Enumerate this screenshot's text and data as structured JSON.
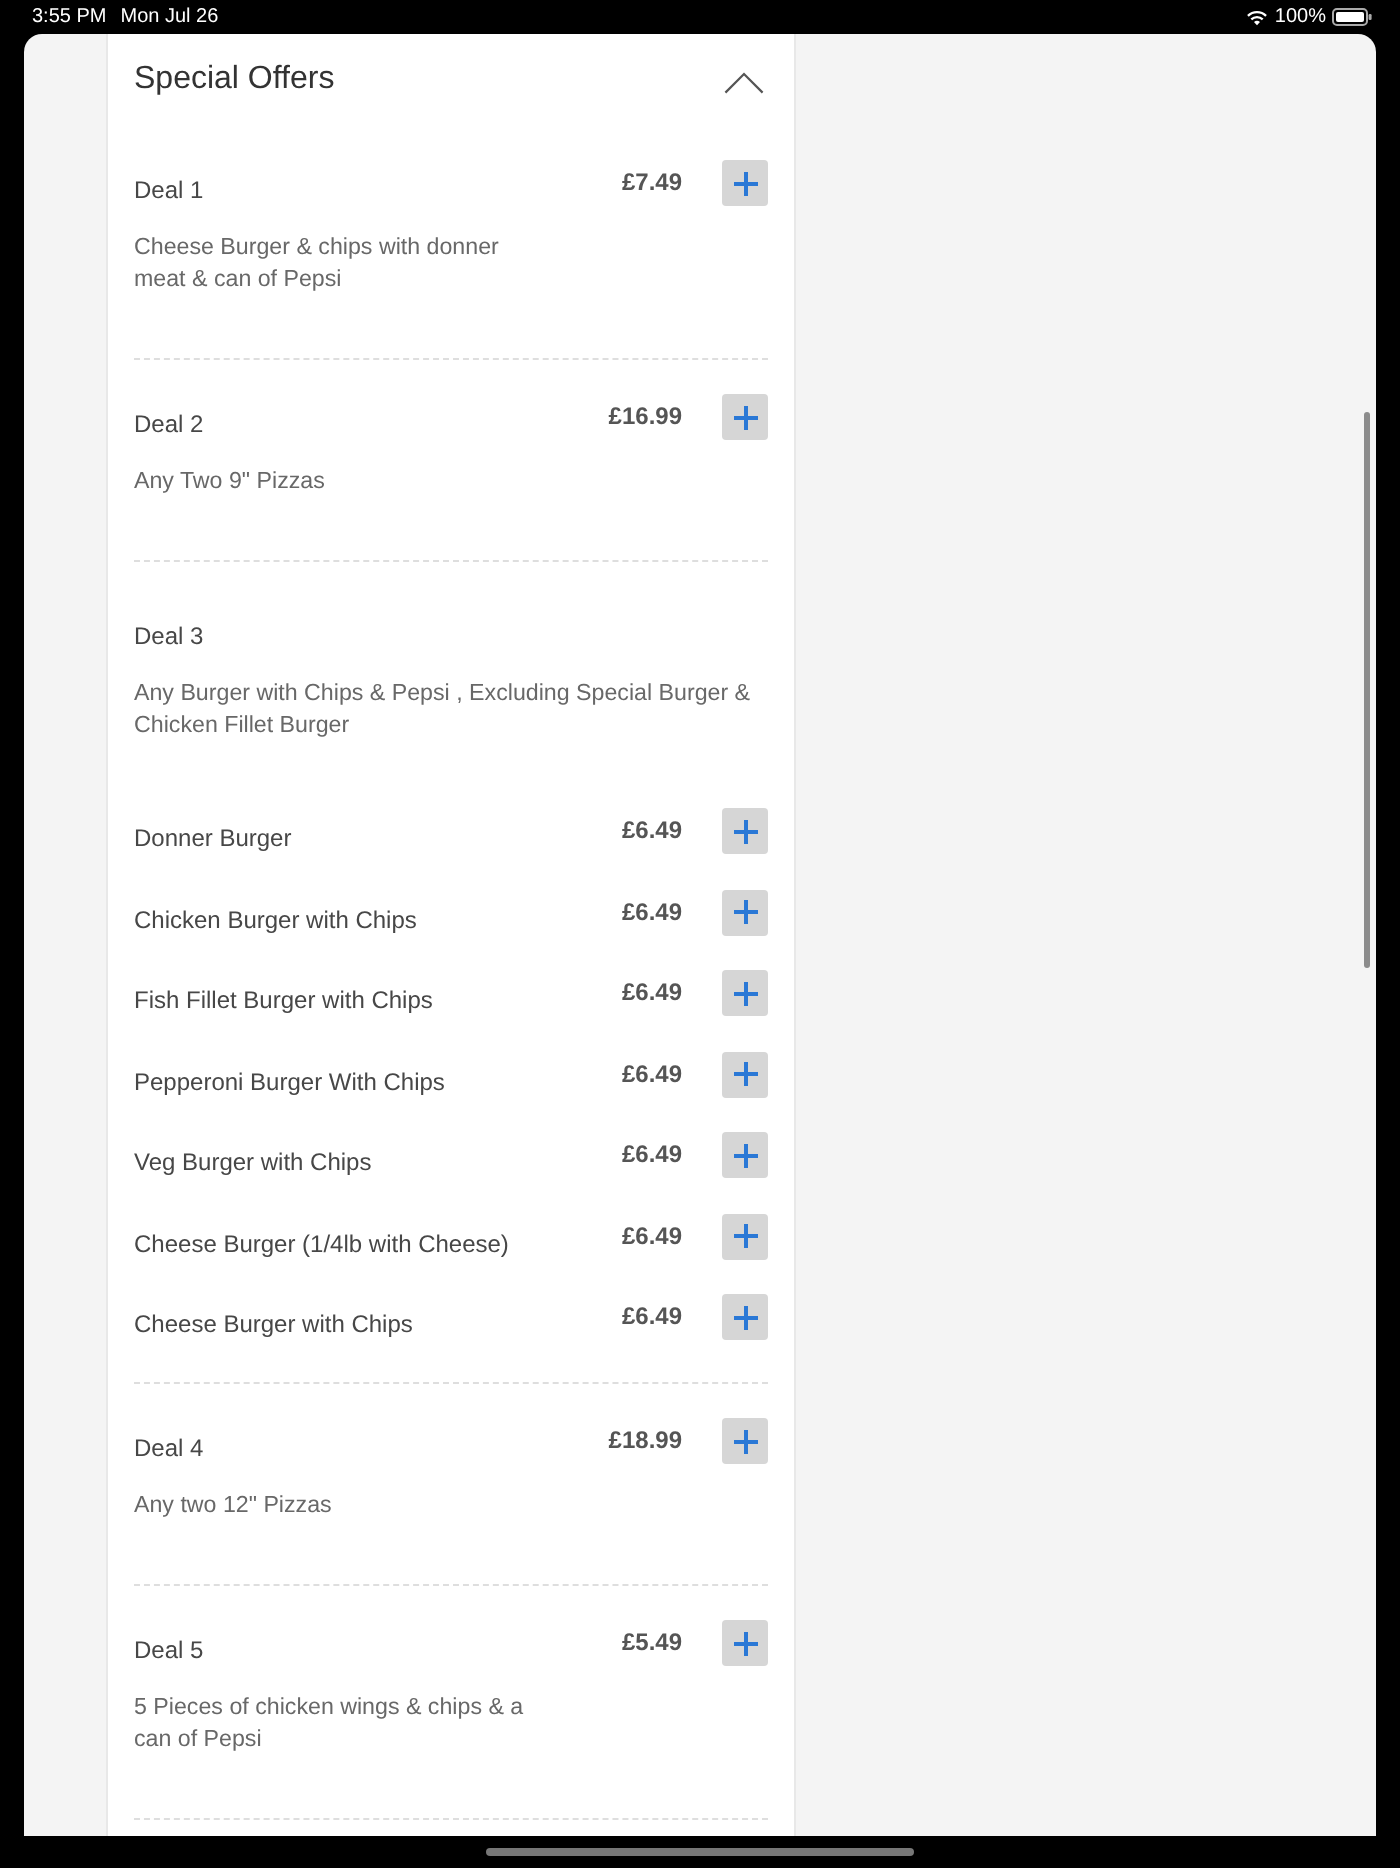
{
  "status_bar": {
    "time": "3:55 PM",
    "date": "Mon Jul 26",
    "battery": "100%"
  },
  "section": {
    "title": "Special Offers",
    "expanded": true,
    "deals": [
      {
        "kind": "deal",
        "title": "Deal 1",
        "price": "£7.49",
        "description": "Cheese Burger & chips with donner meat & can of Pepsi"
      },
      {
        "kind": "deal",
        "title": "Deal 2",
        "price": "£16.99",
        "description": "Any Two 9\" Pizzas"
      },
      {
        "kind": "group",
        "title": "Deal 3",
        "description": "Any Burger with Chips & Pepsi , Excluding Special Burger & Chicken Fillet Burger",
        "items": [
          {
            "name": "Donner Burger",
            "price": "£6.49"
          },
          {
            "name": "Chicken Burger with Chips",
            "price": "£6.49"
          },
          {
            "name": "Fish Fillet Burger with Chips",
            "price": "£6.49"
          },
          {
            "name": "Pepperoni Burger With Chips",
            "price": "£6.49"
          },
          {
            "name": "Veg Burger with Chips",
            "price": "£6.49"
          },
          {
            "name": "Cheese Burger (1/4lb with Cheese)",
            "price": "£6.49"
          },
          {
            "name": "Cheese Burger with Chips",
            "price": "£6.49"
          }
        ]
      },
      {
        "kind": "deal",
        "title": "Deal 4",
        "price": "£18.99",
        "description": "Any two 12\" Pizzas"
      },
      {
        "kind": "deal",
        "title": "Deal 5",
        "price": "£5.49",
        "description": "5 Pieces of chicken wings & chips & a can of Pepsi"
      }
    ]
  }
}
